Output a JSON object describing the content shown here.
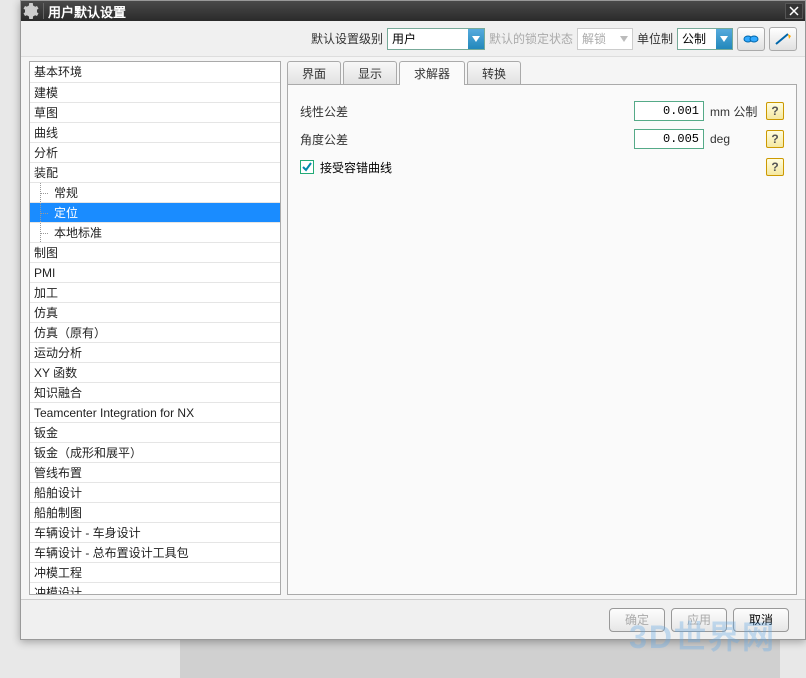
{
  "window": {
    "title": "用户默认设置"
  },
  "toolbar": {
    "level_label": "默认设置级别",
    "level_value": "用户",
    "lock_label": "默认的锁定状态",
    "lock_value": "解锁",
    "units_label": "单位制",
    "units_value": "公制"
  },
  "tree": [
    {
      "label": "基本环境",
      "level": 0
    },
    {
      "label": "建模",
      "level": 0
    },
    {
      "label": "草图",
      "level": 0
    },
    {
      "label": "曲线",
      "level": 0
    },
    {
      "label": "分析",
      "level": 0
    },
    {
      "label": "装配",
      "level": 0
    },
    {
      "label": "常规",
      "level": 1
    },
    {
      "label": "定位",
      "level": 1,
      "selected": true
    },
    {
      "label": "本地标准",
      "level": 1
    },
    {
      "label": "制图",
      "level": 0
    },
    {
      "label": "PMI",
      "level": 0
    },
    {
      "label": "加工",
      "level": 0
    },
    {
      "label": "仿真",
      "level": 0
    },
    {
      "label": "仿真（原有）",
      "level": 0
    },
    {
      "label": "运动分析",
      "level": 0
    },
    {
      "label": "XY 函数",
      "level": 0
    },
    {
      "label": "知识融合",
      "level": 0
    },
    {
      "label": "Teamcenter Integration for NX",
      "level": 0
    },
    {
      "label": "钣金",
      "level": 0
    },
    {
      "label": "钣金（成形和展平）",
      "level": 0
    },
    {
      "label": "管线布置",
      "level": 0
    },
    {
      "label": "船舶设计",
      "level": 0
    },
    {
      "label": "船舶制图",
      "level": 0
    },
    {
      "label": "车辆设计 - 车身设计",
      "level": 0
    },
    {
      "label": "车辆设计 - 总布置设计工具包",
      "level": 0
    },
    {
      "label": "冲模工程",
      "level": 0
    },
    {
      "label": "冲模设计",
      "level": 0
    }
  ],
  "tabs": [
    {
      "label": "界面"
    },
    {
      "label": "显示"
    },
    {
      "label": "求解器",
      "active": true
    },
    {
      "label": "转换"
    }
  ],
  "form": {
    "linear_label": "线性公差",
    "linear_value": "0.001",
    "linear_unit": "mm 公制",
    "angular_label": "角度公差",
    "angular_value": "0.005",
    "angular_unit": "deg",
    "accept_label": "接受容错曲线"
  },
  "footer": {
    "ok": "确定",
    "apply": "应用",
    "cancel": "取消"
  },
  "watermark": "3D世界网"
}
